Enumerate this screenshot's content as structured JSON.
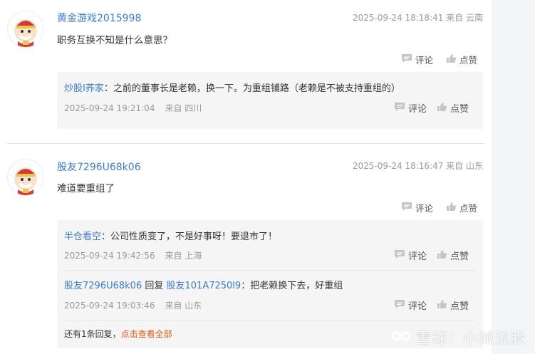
{
  "comments": [
    {
      "author": "黄金游戏2015998",
      "time": "2025-09-24 18:18:41",
      "location": "来自 云南",
      "text": "职务互换不知是什么意思？",
      "comment_label": "评论",
      "like_label": "点赞",
      "replies": [
        {
          "user": "炒股I荞家",
          "text": "：之前的董事长是老赖，换一下。为重组铺路（老赖是不被支持重组的）",
          "time": "2025-09-24 19:21:04",
          "location": "来自 四川",
          "comment_label": "评论",
          "like_label": "点赞"
        }
      ]
    },
    {
      "author": "股友7296U68k06",
      "time": "2025-09-24 18:16:47",
      "location": "来自 山东",
      "text": "难道要重组了",
      "comment_label": "评论",
      "like_label": "点赞",
      "replies": [
        {
          "user": "半仓看空",
          "text": "：公司性质变了，不是好事呀！要退市了！",
          "time": "2025-09-24 19:42:56",
          "location": "来自 上海",
          "comment_label": "评论",
          "like_label": "点赞"
        },
        {
          "user": "股友7296U68k06",
          "reply_word": "回复",
          "target": "股友101A7250l9",
          "text": "：把老赖换下去，好重组",
          "time": "2025-09-24 19:03:46",
          "location": "来自 山东",
          "comment_label": "评论",
          "like_label": "点赞"
        }
      ],
      "more_text": "还有1条回复，",
      "more_link": "点击查看全部"
    }
  ],
  "watermark": "雪球：小城说股",
  "colors": {
    "link": "#3a7bd5",
    "accent": "#e85a12",
    "reply_bg": "#f5f5f5"
  },
  "icons": {
    "comment": "comment-bubble-icon",
    "like": "thumbs-up-icon",
    "watermark": "xueqiu-logo-icon"
  }
}
